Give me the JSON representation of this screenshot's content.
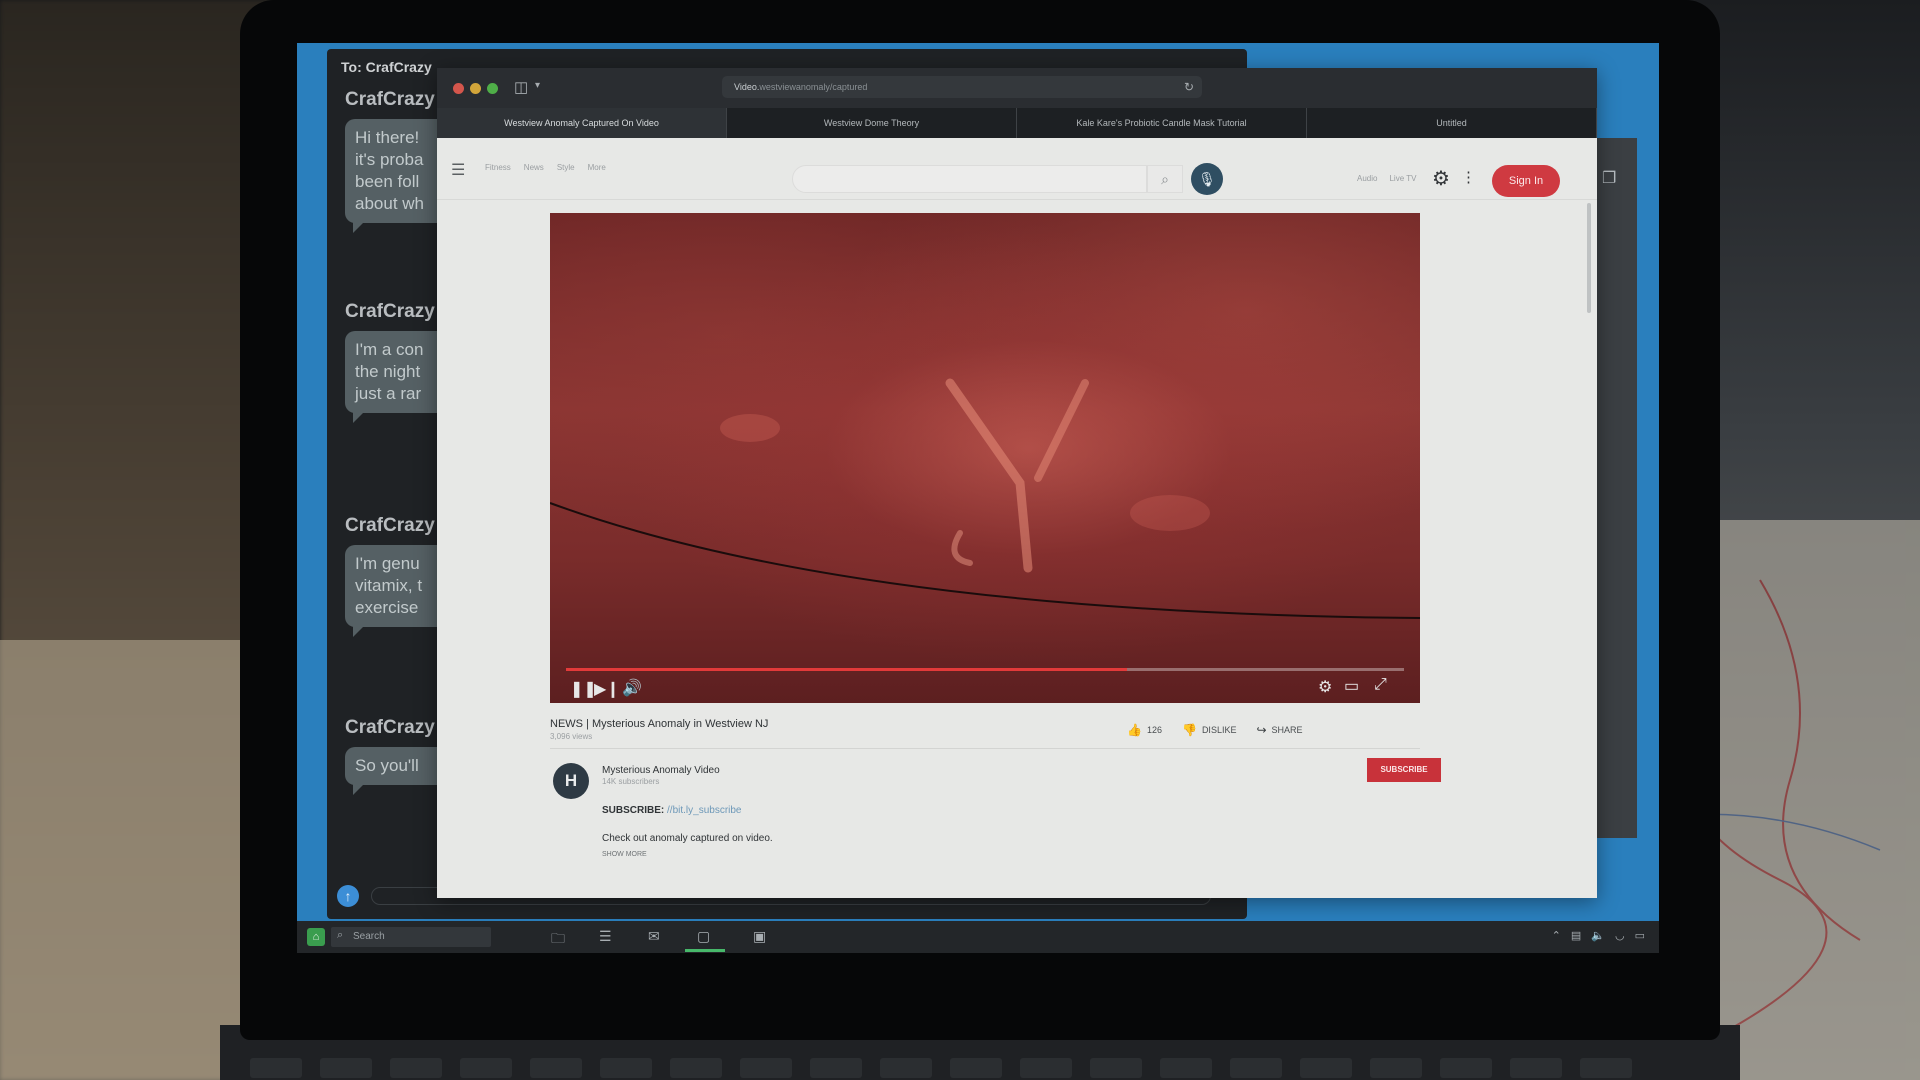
{
  "messages": {
    "to_label": "To: CrafCrazy",
    "threads": [
      {
        "name": "CrafCrazy",
        "text": "Hi there!\nit's proba\nbeen foll\nabout wh"
      },
      {
        "name": "CrafCrazy",
        "text": "I'm a con\nthe night\njust a rar"
      },
      {
        "name": "CrafCrazy",
        "text": "I'm genu\nvitamix, t\nexercise"
      },
      {
        "name": "CrafCrazy",
        "text": "So you'll"
      }
    ]
  },
  "browser": {
    "url_prefix": "Video.",
    "url_rest": "westviewanomaly/captured",
    "tabs": [
      "Westview Anomaly Captured On Video",
      "Westview Dome Theory",
      "Kale Kare's Probiotic Candle Mask Tutorial",
      "Untitled"
    ]
  },
  "site": {
    "nav_links": [
      "Fitness",
      "News",
      "Style",
      "More"
    ],
    "nav_right": [
      "Audio",
      "Live TV"
    ],
    "signin": "Sign In"
  },
  "video": {
    "progress_fraction": 0.67,
    "title": "NEWS | Mysterious Anomaly in Westview NJ",
    "views": "3,096 views",
    "likes": "126",
    "dislike_label": "DISLIKE",
    "share_label": "SHARE",
    "channel": {
      "avatar_letter": "H",
      "name": "Mysterious Anomaly Video",
      "subscribers": "14K subscribers",
      "subscribe_label": "SUBSCRIBE"
    },
    "description": {
      "subscribe_prefix": "SUBSCRIBE:",
      "subscribe_link": "//bit.ly_subscribe",
      "text": "Check out anomaly captured on video.",
      "show_more": "SHOW MORE"
    }
  },
  "taskbar": {
    "search_label": "Search"
  },
  "colors": {
    "signin_red": "#cf3a41",
    "desktop_blue": "#2a7fbd",
    "taskbar_active": "#47b86a"
  },
  "icons": [
    "search-icon",
    "mic-icon",
    "gear-icon",
    "pause-icon",
    "next-icon",
    "volume-icon",
    "theater-icon",
    "fullscreen-icon",
    "thumbs-up-icon",
    "thumbs-down-icon",
    "share-icon"
  ]
}
